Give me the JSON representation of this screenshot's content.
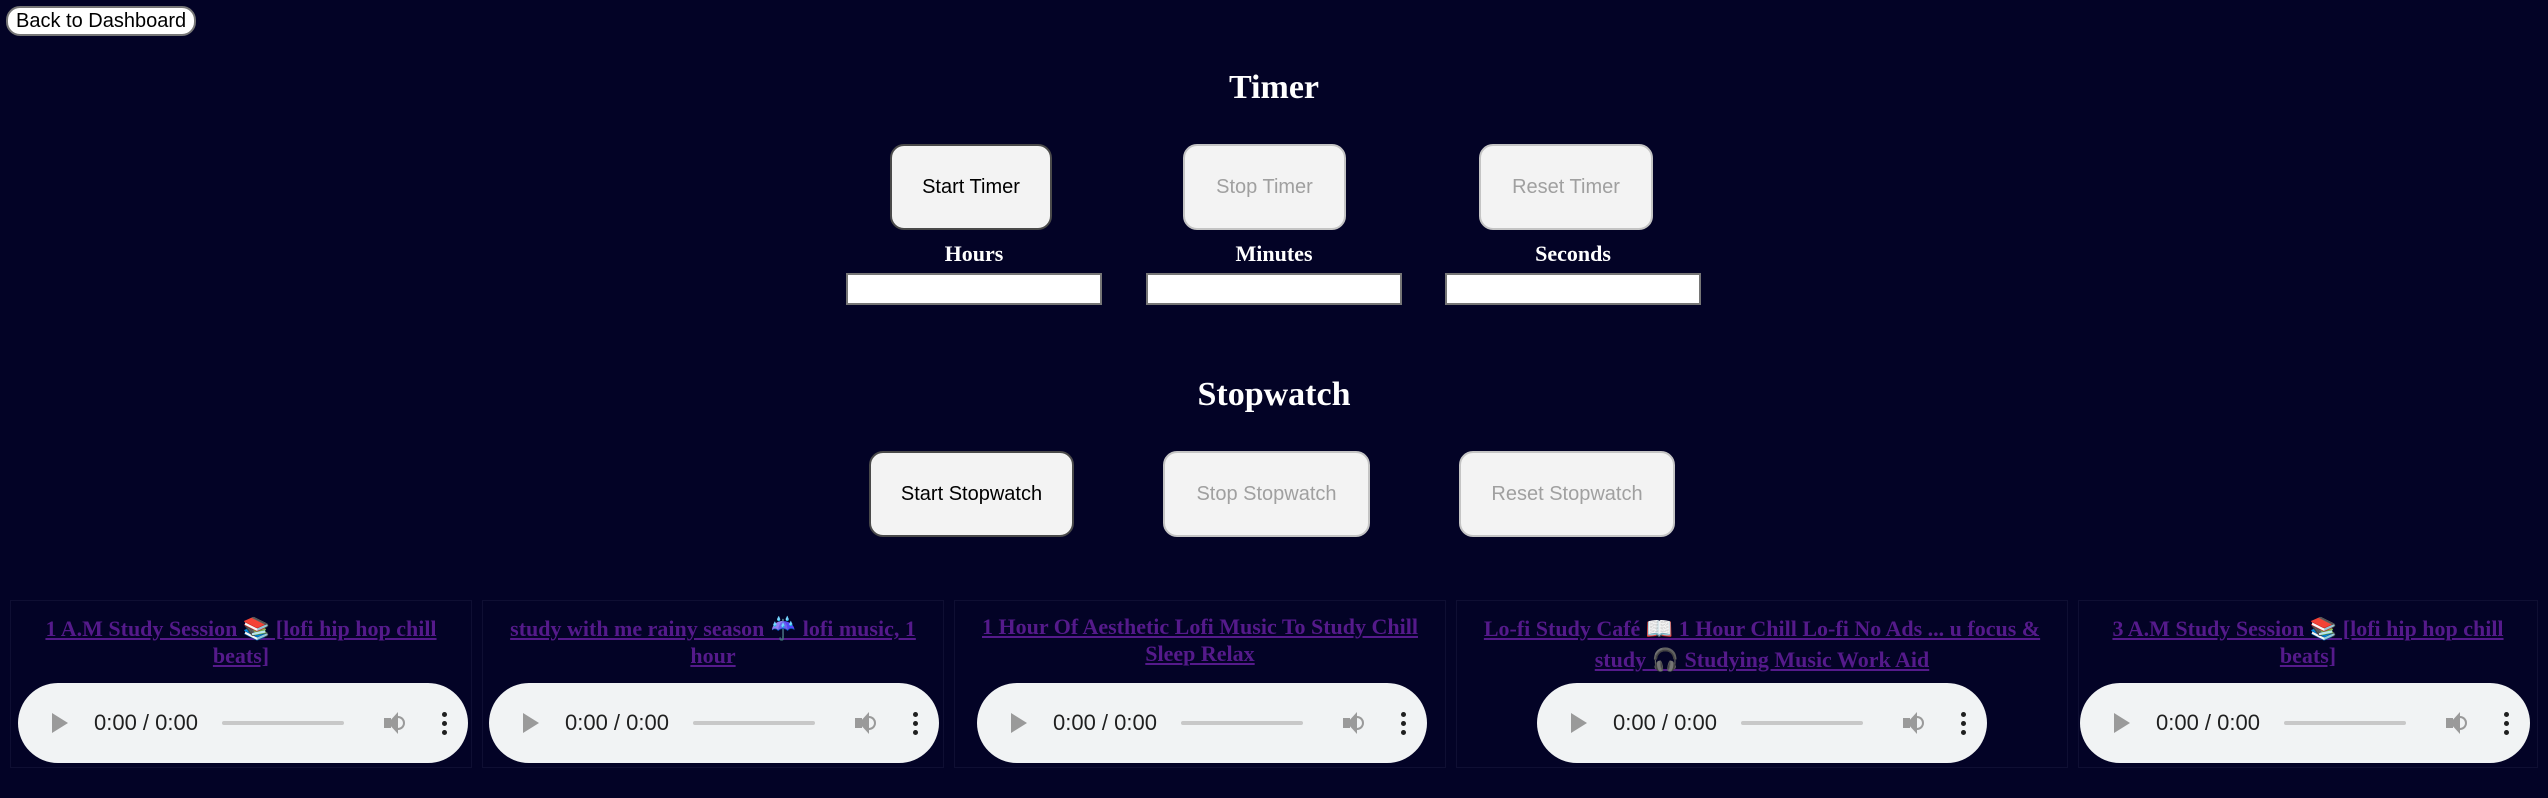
{
  "nav": {
    "back_label": "Back to Dashboard"
  },
  "timer": {
    "title": "Timer",
    "start_label": "Start Timer",
    "stop_label": "Stop Timer",
    "reset_label": "Reset Timer",
    "hours_label": "Hours",
    "minutes_label": "Minutes",
    "seconds_label": "Seconds",
    "hours_value": "",
    "minutes_value": "",
    "seconds_value": ""
  },
  "stopwatch": {
    "title": "Stopwatch",
    "start_label": "Start Stopwatch",
    "stop_label": "Stop Stopwatch",
    "reset_label": "Reset Stopwatch"
  },
  "tracks": [
    {
      "title": "1 A.M Study Session 📚 [lofi hip hop chill beats]",
      "time": "0:00 / 0:00"
    },
    {
      "title": "study with me rainy season ☔ lofi music, 1 hour",
      "time": "0:00 / 0:00"
    },
    {
      "title": "1 Hour Of Aesthetic Lofi Music To Study Chill Sleep Relax",
      "time": "0:00 / 0:00"
    },
    {
      "title": "Lo-fi Study Café 📖 1 Hour Chill Lo-fi No Ads ... u focus & study 🎧 Studying Music Work Aid",
      "time": "0:00 / 0:00"
    },
    {
      "title": "3 A.M Study Session 📚 [lofi hip hop chill beats]",
      "time": "0:00 / 0:00"
    }
  ],
  "colors": {
    "background": "#030326",
    "link": "#551a8b",
    "player_bg": "#f1f3f4"
  }
}
